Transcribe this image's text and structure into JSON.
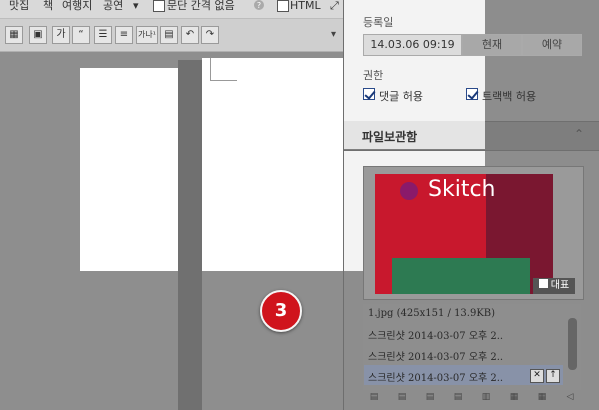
{
  "editor": {
    "menu": [
      "맛집",
      "책",
      "여행지",
      "공연"
    ],
    "paragraph_option": "문단 간격 없음",
    "html_label": "HTML",
    "toolbar_icons": [
      "table-icon",
      "image-icon",
      "text-style-icon",
      "quote-icon",
      "divider-icon",
      "line-icon",
      "superscript-icon",
      "save-icon",
      "undo-icon",
      "redo-icon"
    ],
    "toolbar_glyphs": {
      "quote": "“",
      "superscript": "가나¹",
      "undo": "↶",
      "redo": "↷"
    }
  },
  "step_badge": "3",
  "panel": {
    "date_label": "등록일",
    "date_value": "14.03.06 09:19",
    "now_label": "현재",
    "reserve_label": "예약",
    "permission_label": "권한",
    "comment_allow": "댓글 허용",
    "trackback_allow": "트랙백 허용",
    "storage_title": "파일보관함",
    "thumbnail_brand": "Skitch",
    "representative_label": "대표",
    "files": [
      "1.jpg (425x151 / 13.9KB)",
      "스크린샷 2014-03-07 오후 2..",
      "스크린샷 2014-03-07 오후 2..",
      "스크린샷 2014-03-07 오후 2.."
    ]
  },
  "colors": {
    "badge": "#d0141c",
    "thumbnail": "#c8182d"
  }
}
